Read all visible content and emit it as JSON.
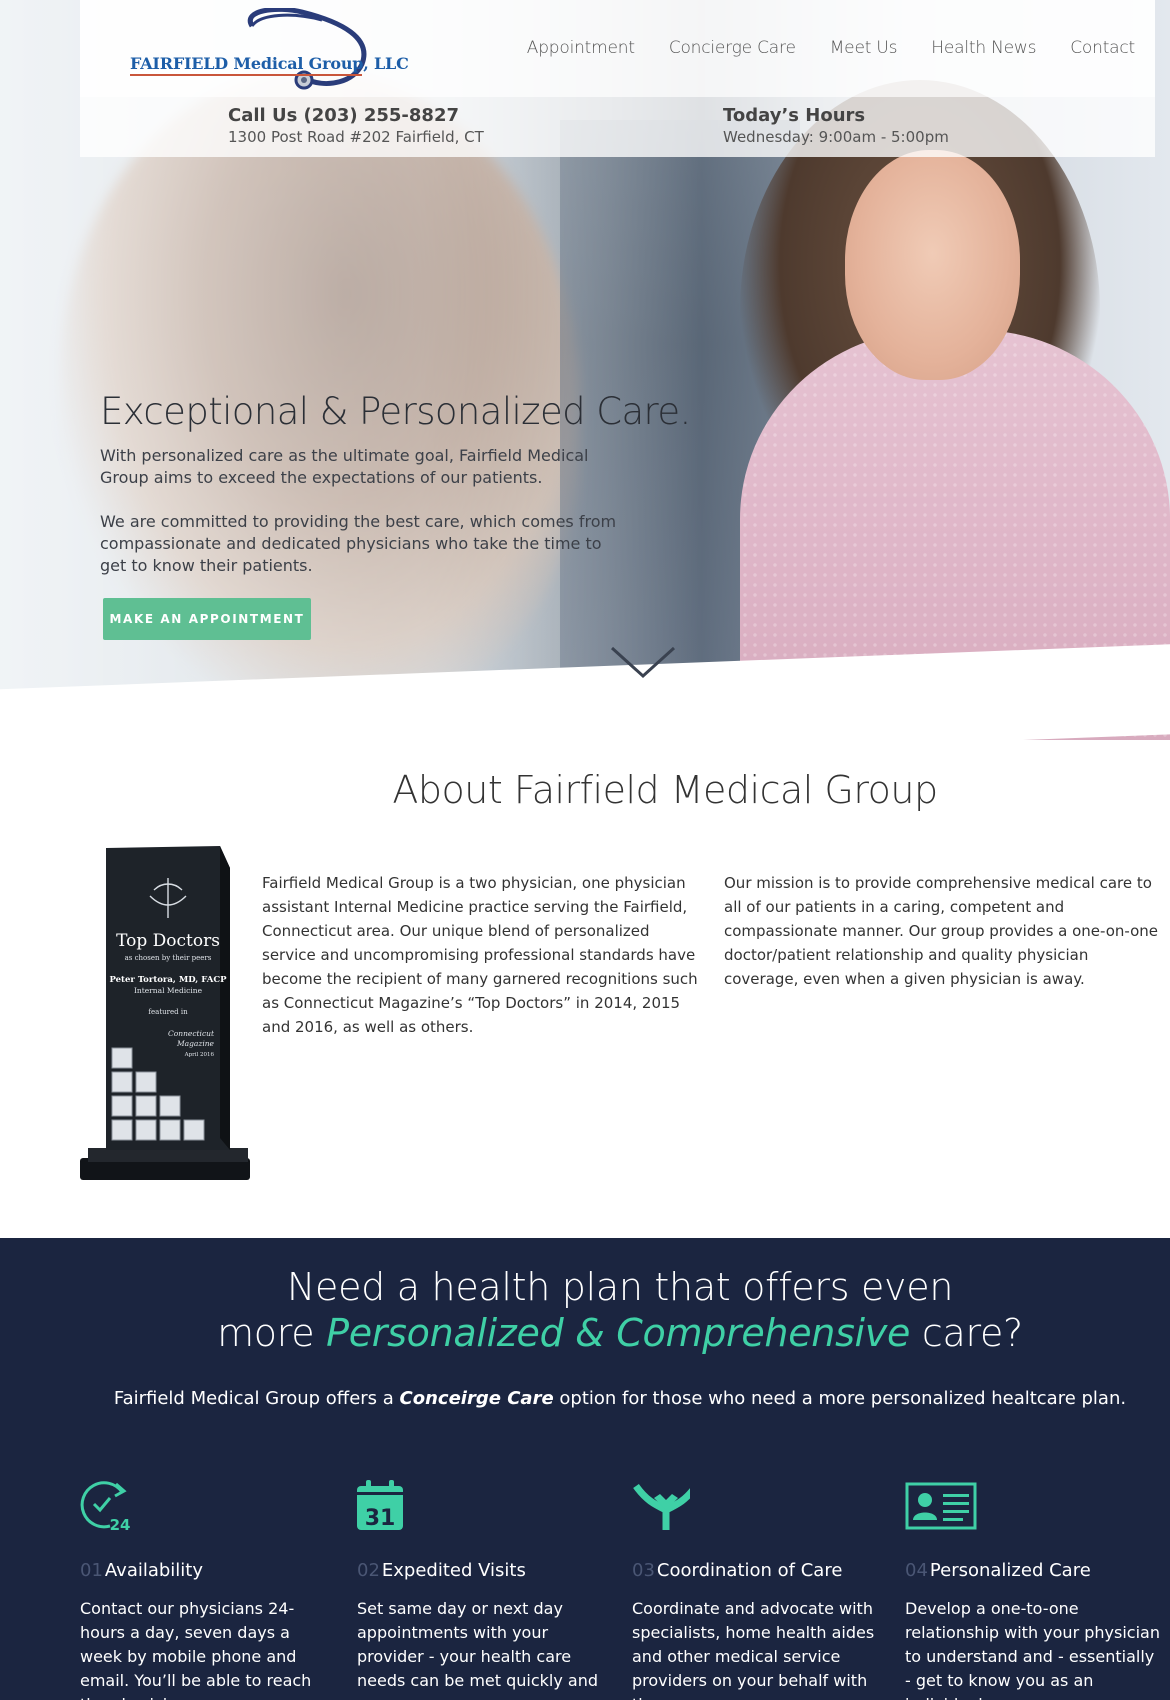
{
  "header": {
    "logo_text": "FAIRFIELD Medical Group, LLC",
    "nav": [
      "Appointment",
      "Concierge Care",
      "Meet Us",
      "Health News",
      "Contact"
    ]
  },
  "infobar": {
    "phone_label": "Call Us (203) 255-8827",
    "address": "1300 Post Road #202 Fairfield, CT",
    "hours_label": "Today’s Hours",
    "hours_value": "Wednesday: 9:00am - 5:00pm"
  },
  "hero": {
    "title": "Exceptional & Personalized Care.",
    "paragraph_1": "With personalized care as the ultimate goal, Fairfield Medical Group aims to exceed the expectations of our patients.",
    "paragraph_2": "We are committed to providing the best care, which comes from compassionate and dedicated physicians who take the time to get to know their patients.",
    "cta_label": "MAKE  AN APPOINTMENT"
  },
  "about": {
    "title": "About Fairfield Medical Group",
    "column_1": "Fairfield Medical Group is a two physician, one physician assistant Internal Medicine practice serving the Fairfield, Connecticut area. Our unique blend of personalized service and uncompromising professional standards have become the recipient of many garnered recognitions such as Connecticut Magazine’s “Top Doctors” in 2014, 2015 and 2016, as well as others.",
    "column_2": "Our mission is to provide comprehensive medical care to all of our patients in a caring, competent and compassionate manner. Our group provides a one-on-one doctor/patient relationship and quality physician coverage, even when a given physician is away.",
    "award": {
      "title": "Top Doctors",
      "subtitle": "as chosen by their peers",
      "name": "Peter Tortora, MD, FACP",
      "specialty": "Internal Medicine",
      "featured": "featured in",
      "magazine_1": "Connecticut",
      "magazine_2": "Magazine",
      "date": "April 2016"
    }
  },
  "plan": {
    "heading_line1": "Need a health plan that offers even",
    "heading_pre": "more ",
    "heading_accent": "Personalized & Comprehensive",
    "heading_post": " care?",
    "sub_pre": "Fairfield Medical Group offers a ",
    "sub_bold": "Conceirge Care",
    "sub_post": " option for those  who need a more personalized healtcare plan.",
    "features": [
      {
        "num": "01",
        "title": "Availability",
        "icon": "clock-24-icon",
        "body": "Contact our physicians 24-hours a day, seven days a week by mobile phone and email. You’ll be able to reach the physicians"
      },
      {
        "num": "02",
        "title": "Expedited Visits",
        "icon": "calendar-31-icon",
        "body": "Set same day or next day appointments with your provider - your health care needs can be met quickly and"
      },
      {
        "num": "03",
        "title": "Coordination of Care",
        "icon": "merge-arrows-icon",
        "body": "Coordinate and advocate with specialists, home health aides and other medical service providers on your behalf with the"
      },
      {
        "num": "04",
        "title": "Personalized Care",
        "icon": "id-card-icon",
        "body": "Develop a one-to-one relationship with your physician to understand and - essentially - get to know you as an individual,"
      }
    ],
    "accent_color": "#3fd0a6",
    "background_color": "#1b2540"
  },
  "colors": {
    "cta": "#5fbf93",
    "logo_blue": "#1d5ea8"
  }
}
